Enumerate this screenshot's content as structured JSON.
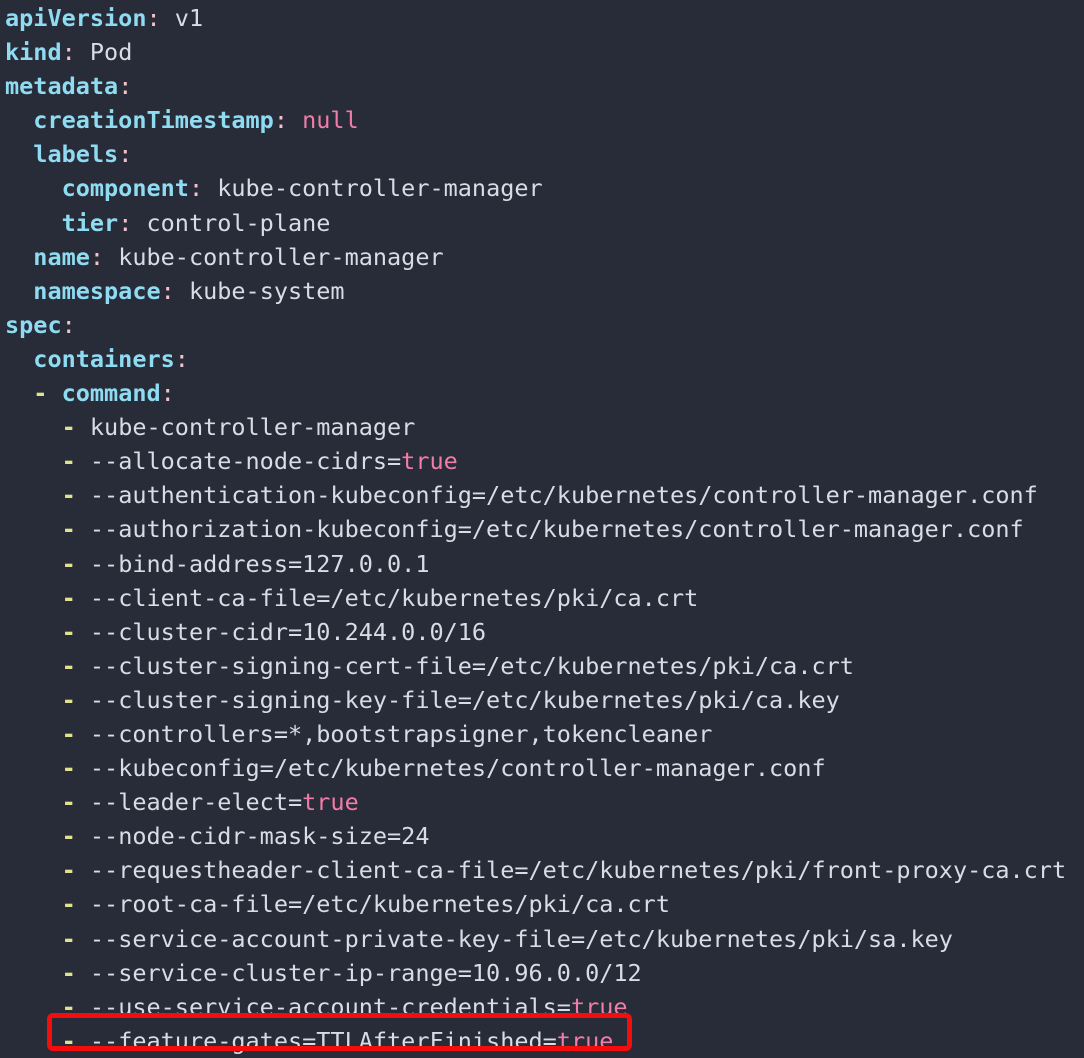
{
  "theme": {
    "background": "#282c38",
    "key_color": "#8fdcf2",
    "colon_color": "#f3c3cb",
    "value_color": "#d8dce4",
    "literal_color": "#f07ca8",
    "dash_color": "#e0e28c",
    "highlight_color": "#f40d0d"
  },
  "document": {
    "language": "yaml",
    "resource_kind": "Pod",
    "resource_name": "kube-controller-manager"
  },
  "lines": [
    {
      "indent": 0,
      "dash": false,
      "key": "apiVersion",
      "value": "v1",
      "value_kind": "plain"
    },
    {
      "indent": 0,
      "dash": false,
      "key": "kind",
      "value": "Pod",
      "value_kind": "plain"
    },
    {
      "indent": 0,
      "dash": false,
      "key": "metadata",
      "value": "",
      "value_kind": "none"
    },
    {
      "indent": 2,
      "dash": false,
      "key": "creationTimestamp",
      "value": "null",
      "value_kind": "literal"
    },
    {
      "indent": 2,
      "dash": false,
      "key": "labels",
      "value": "",
      "value_kind": "none"
    },
    {
      "indent": 4,
      "dash": false,
      "key": "component",
      "value": "kube-controller-manager",
      "value_kind": "plain"
    },
    {
      "indent": 4,
      "dash": false,
      "key": "tier",
      "value": "control-plane",
      "value_kind": "plain"
    },
    {
      "indent": 2,
      "dash": false,
      "key": "name",
      "value": "kube-controller-manager",
      "value_kind": "plain"
    },
    {
      "indent": 2,
      "dash": false,
      "key": "namespace",
      "value": "kube-system",
      "value_kind": "plain"
    },
    {
      "indent": 0,
      "dash": false,
      "key": "spec",
      "value": "",
      "value_kind": "none"
    },
    {
      "indent": 2,
      "dash": false,
      "key": "containers",
      "value": "",
      "value_kind": "none"
    },
    {
      "indent": 2,
      "dash": true,
      "key": "command",
      "value": "",
      "value_kind": "none"
    },
    {
      "indent": 4,
      "dash": true,
      "key": "",
      "value": "kube-controller-manager",
      "value_kind": "plain"
    },
    {
      "indent": 4,
      "dash": true,
      "key": "",
      "value": "--allocate-node-cidrs=",
      "value_kind": "plain",
      "literal_suffix": "true"
    },
    {
      "indent": 4,
      "dash": true,
      "key": "",
      "value": "--authentication-kubeconfig=/etc/kubernetes/controller-manager.conf",
      "value_kind": "plain"
    },
    {
      "indent": 4,
      "dash": true,
      "key": "",
      "value": "--authorization-kubeconfig=/etc/kubernetes/controller-manager.conf",
      "value_kind": "plain"
    },
    {
      "indent": 4,
      "dash": true,
      "key": "",
      "value": "--bind-address=127.0.0.1",
      "value_kind": "plain"
    },
    {
      "indent": 4,
      "dash": true,
      "key": "",
      "value": "--client-ca-file=/etc/kubernetes/pki/ca.crt",
      "value_kind": "plain"
    },
    {
      "indent": 4,
      "dash": true,
      "key": "",
      "value": "--cluster-cidr=10.244.0.0/16",
      "value_kind": "plain"
    },
    {
      "indent": 4,
      "dash": true,
      "key": "",
      "value": "--cluster-signing-cert-file=/etc/kubernetes/pki/ca.crt",
      "value_kind": "plain"
    },
    {
      "indent": 4,
      "dash": true,
      "key": "",
      "value": "--cluster-signing-key-file=/etc/kubernetes/pki/ca.key",
      "value_kind": "plain"
    },
    {
      "indent": 4,
      "dash": true,
      "key": "",
      "value": "--controllers=*,bootstrapsigner,tokencleaner",
      "value_kind": "plain"
    },
    {
      "indent": 4,
      "dash": true,
      "key": "",
      "value": "--kubeconfig=/etc/kubernetes/controller-manager.conf",
      "value_kind": "plain"
    },
    {
      "indent": 4,
      "dash": true,
      "key": "",
      "value": "--leader-elect=",
      "value_kind": "plain",
      "literal_suffix": "true"
    },
    {
      "indent": 4,
      "dash": true,
      "key": "",
      "value": "--node-cidr-mask-size=24",
      "value_kind": "plain"
    },
    {
      "indent": 4,
      "dash": true,
      "key": "",
      "value": "--requestheader-client-ca-file=/etc/kubernetes/pki/front-proxy-ca.crt",
      "value_kind": "plain"
    },
    {
      "indent": 4,
      "dash": true,
      "key": "",
      "value": "--root-ca-file=/etc/kubernetes/pki/ca.crt",
      "value_kind": "plain"
    },
    {
      "indent": 4,
      "dash": true,
      "key": "",
      "value": "--service-account-private-key-file=/etc/kubernetes/pki/sa.key",
      "value_kind": "plain"
    },
    {
      "indent": 4,
      "dash": true,
      "key": "",
      "value": "--service-cluster-ip-range=10.96.0.0/12",
      "value_kind": "plain"
    },
    {
      "indent": 4,
      "dash": true,
      "key": "",
      "value": "--use-service-account-credentials=",
      "value_kind": "plain",
      "literal_suffix": "true"
    },
    {
      "indent": 4,
      "dash": true,
      "key": "",
      "value": "--feature-gates=TTLAfterFinished=",
      "value_kind": "plain",
      "literal_suffix": "true",
      "highlighted": true
    }
  ],
  "highlight": {
    "label": "feature-gates-highlight",
    "line_index": 30,
    "text": "- --feature-gates=TTLAfterFinished=true"
  }
}
